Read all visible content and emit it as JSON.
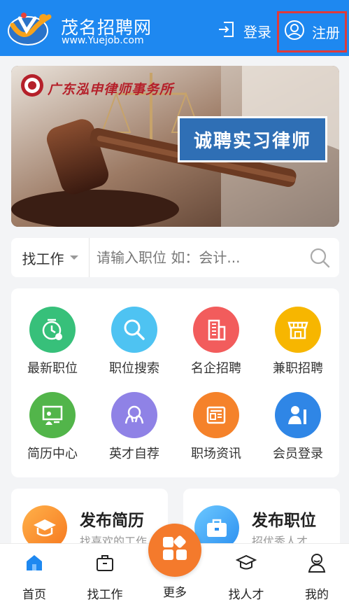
{
  "header": {
    "title": "茂名招聘网",
    "url": "www.Yuejob.com",
    "login_label": "登录",
    "register_label": "注册"
  },
  "banner": {
    "firm_name": "广东泓申律师事务所",
    "slogan": "诚聘实习律师"
  },
  "search": {
    "type_label": "找工作",
    "placeholder": "请输入职位 如：会计..."
  },
  "grid": [
    {
      "label": "最新职位",
      "icon": "clock-icon",
      "color": "#37c07a"
    },
    {
      "label": "职位搜索",
      "icon": "magnifier-icon",
      "color": "#4ec3f2"
    },
    {
      "label": "名企招聘",
      "icon": "building-icon",
      "color": "#f25c5c"
    },
    {
      "label": "兼职招聘",
      "icon": "shop-icon",
      "color": "#f7b600"
    },
    {
      "label": "简历中心",
      "icon": "presentation-icon",
      "color": "#52b54a"
    },
    {
      "label": "英才自荐",
      "icon": "hands-icon",
      "color": "#8f82e6"
    },
    {
      "label": "职场资讯",
      "icon": "news-icon",
      "color": "#f5822a"
    },
    {
      "label": "会员登录",
      "icon": "member-icon",
      "color": "#2f86e6"
    }
  ],
  "publish": {
    "resume_title": "发布简历",
    "resume_sub": "找喜欢的工作",
    "job_title": "发布职位",
    "job_sub": "招优秀人才"
  },
  "nav": {
    "home": "首页",
    "jobs": "找工作",
    "more": "更多",
    "talent": "找人才",
    "mine": "我的"
  },
  "colors": {
    "brand": "#1e88f0",
    "accent": "#f47a2c",
    "highlight_box": "#e03a3a"
  }
}
